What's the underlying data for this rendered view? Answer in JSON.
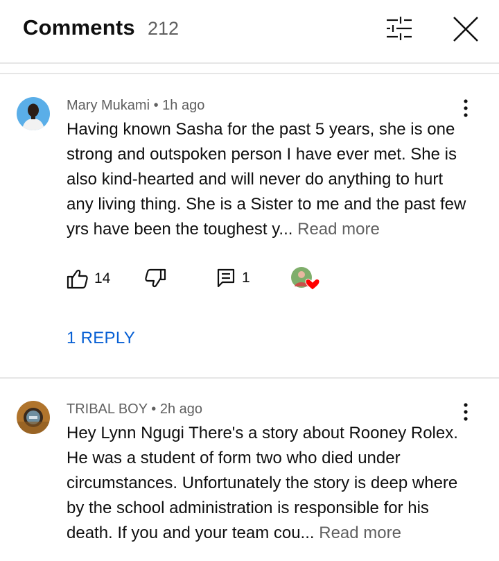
{
  "header": {
    "title": "Comments",
    "count": "212",
    "filter_icon": "sliders-icon",
    "close_icon": "close-icon"
  },
  "comments": [
    {
      "author": "Mary Mukami",
      "separator": "•",
      "time": "1h ago",
      "text": "Having known Sasha for the past 5 years, she is one strong and outspoken person I have ever met. She is also kind-hearted and will never do anything to hurt any living thing. She is a Sister to me and the past few yrs have been the toughest y...",
      "read_more": "Read more",
      "likes": "14",
      "replies_count": "1",
      "reply_link": "1 REPLY",
      "heart_color": "#ff0000"
    },
    {
      "author": "TRIBAL BOY",
      "separator": "•",
      "time": "2h ago",
      "text": "Hey Lynn Ngugi There's a story about Rooney Rolex. He was a student of form two who died under circumstances. Unfortunately the story is deep where by the school administration is responsible for his death. If you and your team cou...",
      "read_more": "Read more"
    }
  ],
  "colors": {
    "link": "#065fd4",
    "secondary_text": "#606060",
    "divider": "#e6e6e6"
  }
}
